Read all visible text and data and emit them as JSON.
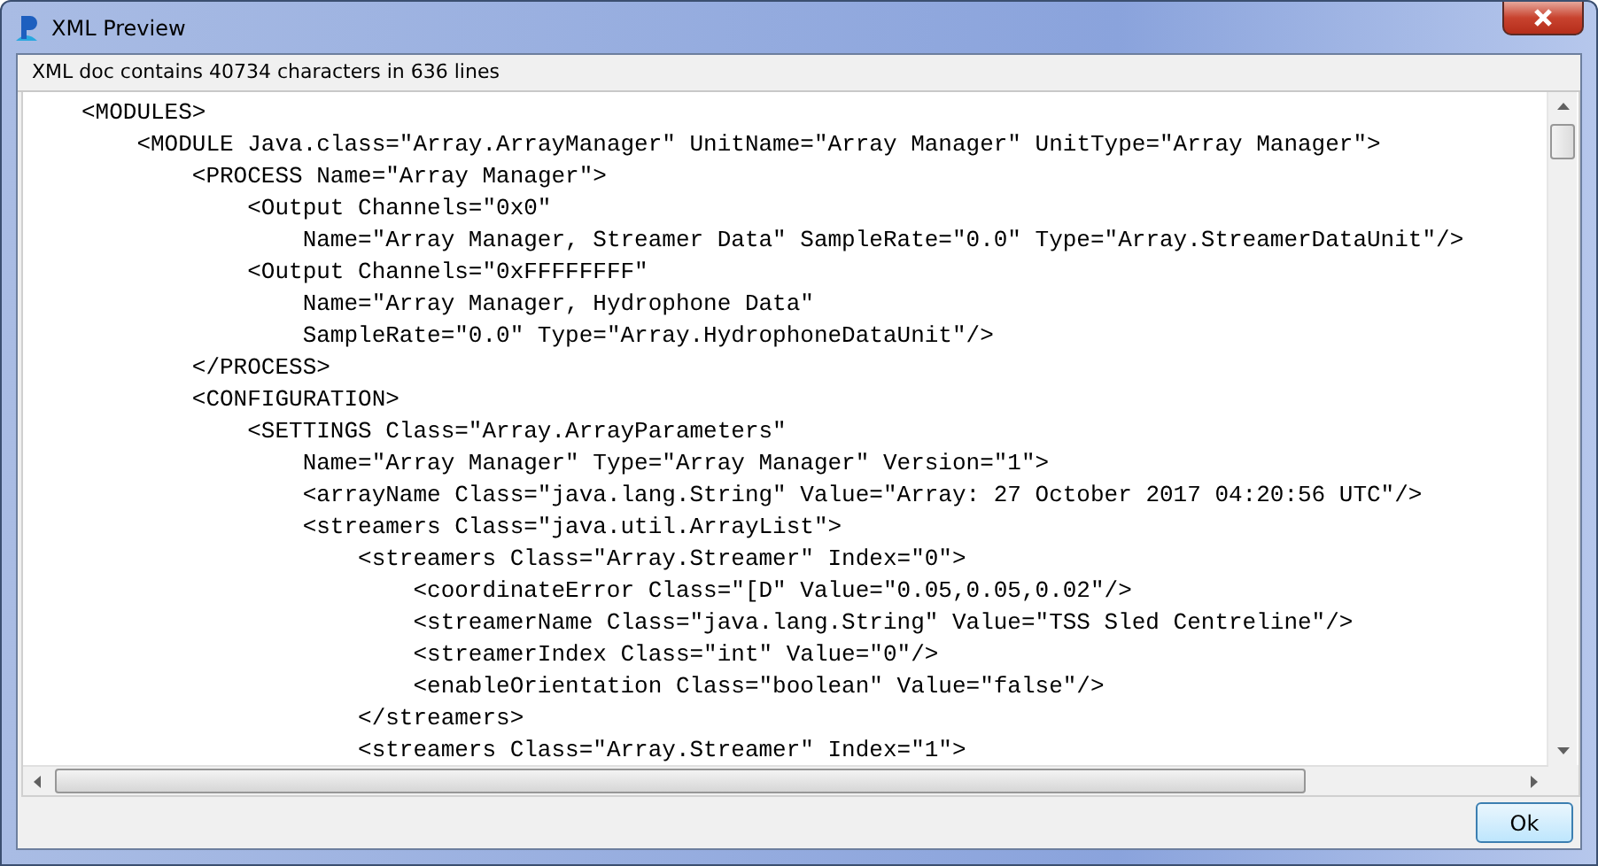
{
  "window": {
    "title": "XML Preview"
  },
  "header": {
    "text": "XML doc contains 40734 characters in 636 lines"
  },
  "xml_lines": [
    {
      "text": "<MODULES>",
      "children": [
        {
          "text": "<MODULE Java.class=\"Array.ArrayManager\" UnitName=\"Array Manager\" UnitType=\"Array Manager\">",
          "children": [
            {
              "text": "<PROCESS Name=\"Array Manager\">",
              "children": [
                {
                  "text": "<Output Channels=\"0x0\"",
                  "children": [
                    {
                      "text": "Name=\"Array Manager, Streamer Data\" SampleRate=\"0.0\" Type=\"Array.StreamerDataUnit\"/>"
                    }
                  ]
                },
                {
                  "text": "<Output Channels=\"0xFFFFFFFF\"",
                  "children": [
                    {
                      "text": "Name=\"Array Manager, Hydrophone Data\""
                    },
                    {
                      "text": "SampleRate=\"0.0\" Type=\"Array.HydrophoneDataUnit\"/>"
                    }
                  ]
                }
              ]
            },
            {
              "text": "</PROCESS>"
            },
            {
              "text": "<CONFIGURATION>",
              "children": [
                {
                  "text": "<SETTINGS Class=\"Array.ArrayParameters\"",
                  "children": [
                    {
                      "text": "Name=\"Array Manager\" Type=\"Array Manager\" Version=\"1\">"
                    },
                    {
                      "text": "<arrayName Class=\"java.lang.String\" Value=\"Array: 27 October 2017 04:20:56 UTC\"/>"
                    },
                    {
                      "text": "<streamers Class=\"java.util.ArrayList\">",
                      "children": [
                        {
                          "text": "<streamers Class=\"Array.Streamer\" Index=\"0\">",
                          "children": [
                            {
                              "text": "<coordinateError Class=\"[D\" Value=\"0.05,0.05,0.02\"/>"
                            },
                            {
                              "text": "<streamerName Class=\"java.lang.String\" Value=\"TSS Sled Centreline\"/>"
                            },
                            {
                              "text": "<streamerIndex Class=\"int\" Value=\"0\"/>"
                            },
                            {
                              "text": "<enableOrientation Class=\"boolean\" Value=\"false\"/>"
                            }
                          ]
                        },
                        {
                          "text": "</streamers>"
                        },
                        {
                          "text": "<streamers Class=\"Array.Streamer\" Index=\"1\">"
                        }
                      ]
                    }
                  ]
                }
              ]
            }
          ]
        }
      ]
    }
  ],
  "buttons": [
    {
      "label": "Ok"
    }
  ]
}
